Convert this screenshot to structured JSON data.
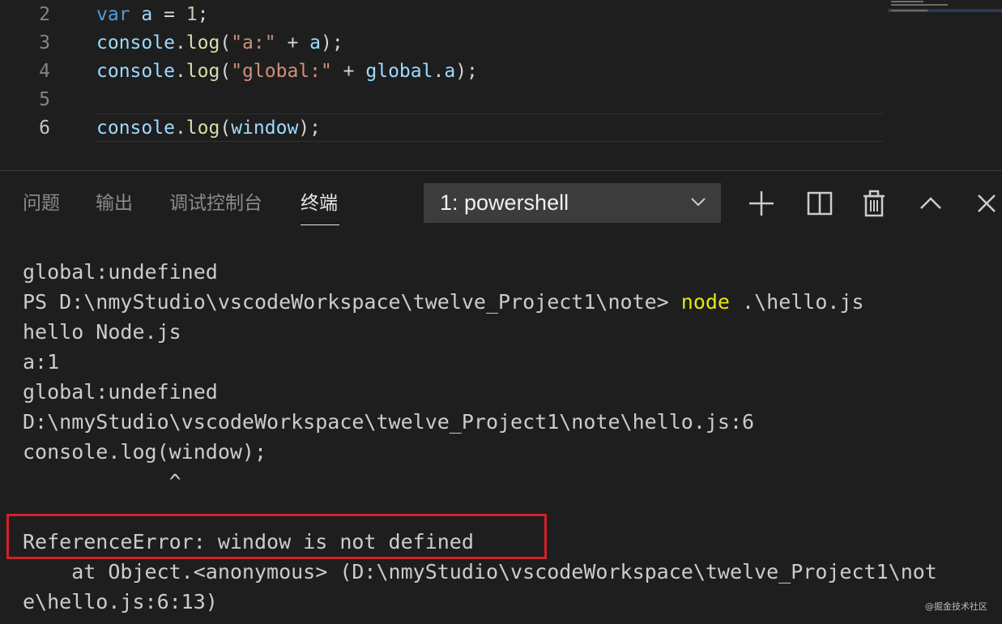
{
  "editor": {
    "lines": [
      {
        "number": "2",
        "tokens": [
          {
            "t": "var",
            "c": "kw"
          },
          {
            "t": " ",
            "c": "punc"
          },
          {
            "t": "a",
            "c": "var"
          },
          {
            "t": " = ",
            "c": "punc"
          },
          {
            "t": "1",
            "c": "num"
          },
          {
            "t": ";",
            "c": "punc"
          }
        ]
      },
      {
        "number": "3",
        "tokens": [
          {
            "t": "console",
            "c": "var"
          },
          {
            "t": ".",
            "c": "punc"
          },
          {
            "t": "log",
            "c": "fn"
          },
          {
            "t": "(",
            "c": "punc"
          },
          {
            "t": "\"a:\"",
            "c": "str"
          },
          {
            "t": " + ",
            "c": "punc"
          },
          {
            "t": "a",
            "c": "var"
          },
          {
            "t": ");",
            "c": "punc"
          }
        ]
      },
      {
        "number": "4",
        "tokens": [
          {
            "t": "console",
            "c": "var"
          },
          {
            "t": ".",
            "c": "punc"
          },
          {
            "t": "log",
            "c": "fn"
          },
          {
            "t": "(",
            "c": "punc"
          },
          {
            "t": "\"global:\"",
            "c": "str"
          },
          {
            "t": " + ",
            "c": "punc"
          },
          {
            "t": "global",
            "c": "var"
          },
          {
            "t": ".",
            "c": "punc"
          },
          {
            "t": "a",
            "c": "var"
          },
          {
            "t": ");",
            "c": "punc"
          }
        ]
      },
      {
        "number": "5",
        "tokens": []
      },
      {
        "number": "6",
        "tokens": [
          {
            "t": "console",
            "c": "var"
          },
          {
            "t": ".",
            "c": "punc"
          },
          {
            "t": "log",
            "c": "fn"
          },
          {
            "t": "(",
            "c": "punc"
          },
          {
            "t": "window",
            "c": "var"
          },
          {
            "t": ");",
            "c": "punc"
          }
        ]
      }
    ],
    "active_line": "6"
  },
  "panel": {
    "tabs": [
      {
        "label": "问题",
        "name": "tab-problems"
      },
      {
        "label": "输出",
        "name": "tab-output"
      },
      {
        "label": "调试控制台",
        "name": "tab-debug-console"
      },
      {
        "label": "终端",
        "name": "tab-terminal"
      }
    ],
    "active_tab": "终端",
    "terminal_select": "1: powershell",
    "icons": [
      "plus-icon",
      "split-icon",
      "trash-icon",
      "chevron-up-icon",
      "close-icon"
    ]
  },
  "terminal": {
    "lines": [
      [
        {
          "t": "global:undefined"
        }
      ],
      [
        {
          "t": "PS D:\\nmyStudio\\vscodeWorkspace\\twelve_Project1\\note> "
        },
        {
          "t": "node",
          "y": true
        },
        {
          "t": " .\\hello.js"
        }
      ],
      [
        {
          "t": "hello Node.js"
        }
      ],
      [
        {
          "t": "a:1"
        }
      ],
      [
        {
          "t": "global:undefined"
        }
      ],
      [
        {
          "t": "D:\\nmyStudio\\vscodeWorkspace\\twelve_Project1\\note\\hello.js:6"
        }
      ],
      [
        {
          "t": "console.log(window);"
        }
      ],
      [
        {
          "t": "            ^"
        }
      ],
      [
        {
          "t": ""
        }
      ],
      [
        {
          "t": "ReferenceError: window is not defined"
        }
      ],
      [
        {
          "t": "    at Object.<anonymous> (D:\\nmyStudio\\vscodeWorkspace\\twelve_Project1\\not"
        }
      ],
      [
        {
          "t": "e\\hello.js:6:13)"
        }
      ]
    ]
  },
  "watermark": "@掘金技术社区",
  "colors": {
    "background": "#1e1e1e",
    "error_box": "#d32029",
    "command_highlight": "#e5e510"
  }
}
